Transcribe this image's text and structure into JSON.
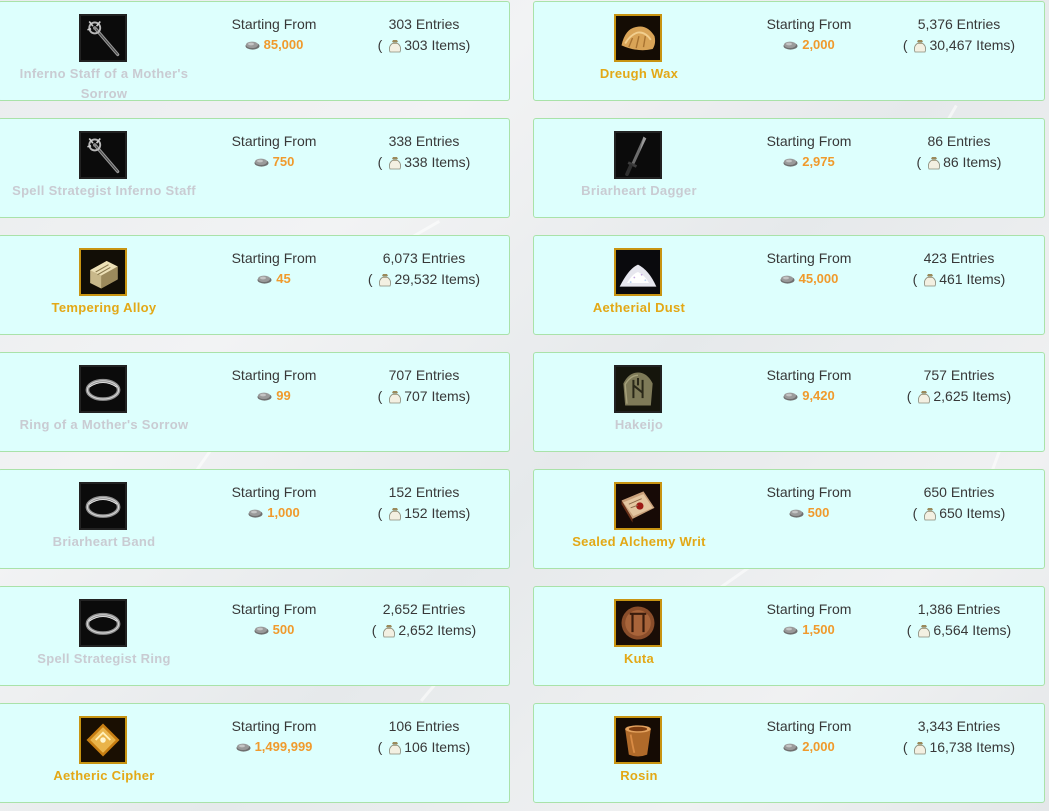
{
  "labels": {
    "starting_from": "Starting From"
  },
  "listings": [
    {
      "name": "Inferno Staff of a Mother's Sorrow",
      "icon": "staff-icon",
      "tier": "dim",
      "price": "85,000",
      "entries": "303 Entries",
      "items": "303 Items)"
    },
    {
      "name": "Dreugh Wax",
      "icon": "dreugh-wax-icon",
      "tier": "gold",
      "price": "2,000",
      "entries": "5,376 Entries",
      "items": "30,467 Items)"
    },
    {
      "name": "Spell Strategist Inferno Staff",
      "icon": "staff-icon",
      "tier": "dim",
      "price": "750",
      "entries": "338 Entries",
      "items": "338 Items)"
    },
    {
      "name": "Briarheart Dagger",
      "icon": "dagger-icon",
      "tier": "dim",
      "price": "2,975",
      "entries": "86 Entries",
      "items": "86 Items)"
    },
    {
      "name": "Tempering Alloy",
      "icon": "alloy-icon",
      "tier": "gold",
      "price": "45",
      "entries": "6,073 Entries",
      "items": "29,532 Items)"
    },
    {
      "name": "Aetherial Dust",
      "icon": "dust-icon",
      "tier": "gold",
      "price": "45,000",
      "entries": "423 Entries",
      "items": "461 Items)"
    },
    {
      "name": "Ring of a Mother's Sorrow",
      "icon": "ring-icon",
      "tier": "dim",
      "price": "99",
      "entries": "707 Entries",
      "items": "707 Items)"
    },
    {
      "name": "Hakeijo",
      "icon": "rune-stone-icon",
      "tier": "dim",
      "price": "9,420",
      "entries": "757 Entries",
      "items": "2,625 Items)"
    },
    {
      "name": "Briarheart Band",
      "icon": "ring-icon",
      "tier": "dim",
      "price": "1,000",
      "entries": "152 Entries",
      "items": "152 Items)"
    },
    {
      "name": "Sealed Alchemy Writ",
      "icon": "writ-icon",
      "tier": "gold",
      "price": "500",
      "entries": "650 Entries",
      "items": "650 Items)"
    },
    {
      "name": "Spell Strategist Ring",
      "icon": "ring-icon",
      "tier": "dim",
      "price": "500",
      "entries": "2,652 Entries",
      "items": "2,652 Items)"
    },
    {
      "name": "Kuta",
      "icon": "kuta-rune-icon",
      "tier": "gold",
      "price": "1,500",
      "entries": "1,386 Entries",
      "items": "6,564 Items)"
    },
    {
      "name": "Aetheric Cipher",
      "icon": "cipher-icon",
      "tier": "gold",
      "price": "1,499,999",
      "entries": "106 Entries",
      "items": "106 Items)"
    },
    {
      "name": "Rosin",
      "icon": "rosin-icon",
      "tier": "gold",
      "price": "2,000",
      "entries": "3,343 Entries",
      "items": "16,738 Items)"
    }
  ],
  "colors": {
    "card_bg": "#ddfffd",
    "card_border": "#a9e2a9",
    "price": "#f09a2c",
    "name_gold": "#e3a816",
    "name_dim": "#c9cbd2",
    "icon_frame_gold": "#c89412"
  }
}
